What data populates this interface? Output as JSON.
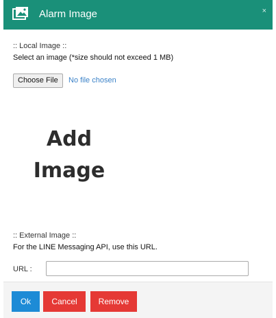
{
  "dialog": {
    "title": "Alarm Image",
    "close_symbol": "×",
    "icon": "image-icon",
    "header_color": "#1a9079"
  },
  "local": {
    "label": ":: Local Image ::",
    "description": "Select an image (*size should not exceed 1 MB)",
    "choose_button": "Choose File",
    "file_status": "No file chosen"
  },
  "preview": {
    "line1": "Add",
    "line2": "Image"
  },
  "external": {
    "label": ":: External Image ::",
    "description": "For the LINE Messaging API, use this URL.",
    "url_label": "URL :",
    "url_value": ""
  },
  "footer": {
    "ok_label": "Ok",
    "cancel_label": "Cancel",
    "remove_label": "Remove",
    "ok_color": "#1d8bd6",
    "danger_color": "#e53935"
  }
}
